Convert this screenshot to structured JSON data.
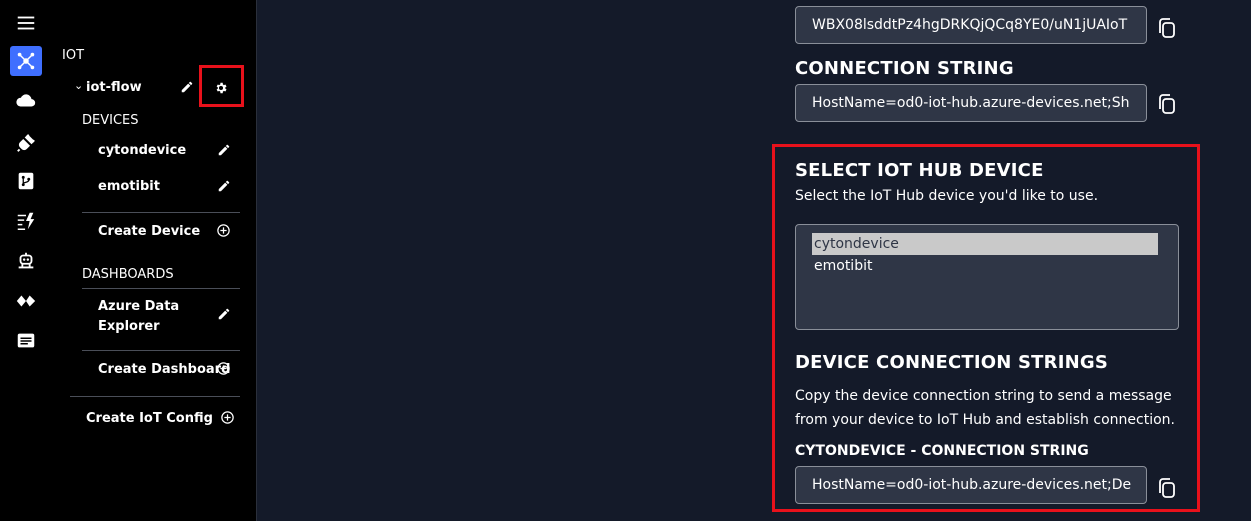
{
  "rail": {
    "icons": [
      "menu-icon",
      "hub-network-icon",
      "cloud-icon",
      "plug-icon",
      "git-repo-icon",
      "flow-lightning-icon",
      "robot-icon",
      "diamond-pair-icon",
      "message-icon"
    ]
  },
  "tree": {
    "section_iot": "IOT",
    "project_name": "iot-flow",
    "section_devices": "DEVICES",
    "devices": [
      "cytondevice",
      "emotibit"
    ],
    "create_device": "Create Device",
    "section_dashboards": "DASHBOARDS",
    "dashboard_line1": "Azure Data",
    "dashboard_line2": "Explorer",
    "create_dashboard": "Create Dashboard",
    "create_config": "Create IoT Config"
  },
  "main": {
    "shared_key_value": "WBX08lsddtPz4hgDRKQjQCq8YE0/uN1jUAIoT",
    "connection_string_heading": "CONNECTION STRING",
    "connection_string_value": "HostName=od0-iot-hub.azure-devices.net;Sh",
    "select_device_heading": "SELECT IOT HUB DEVICE",
    "select_device_desc": "Select the IoT Hub device you'd like to use.",
    "device_options": [
      "cytondevice",
      "emotibit"
    ],
    "selected_device": "cytondevice",
    "device_conn_heading": "DEVICE CONNECTION STRINGS",
    "device_conn_desc_line1": "Copy the device connection string to send a message",
    "device_conn_desc_line2": "from your device to IoT Hub and establish connection.",
    "cyton_conn_label": "CYTONDEVICE - CONNECTION STRING",
    "cyton_conn_value": "HostName=od0-iot-hub.azure-devices.net;De"
  },
  "colors": {
    "accent": "#3f6fff",
    "highlight": "#e8111b",
    "field_bg": "#2f3646",
    "page_bg": "#141a29"
  }
}
